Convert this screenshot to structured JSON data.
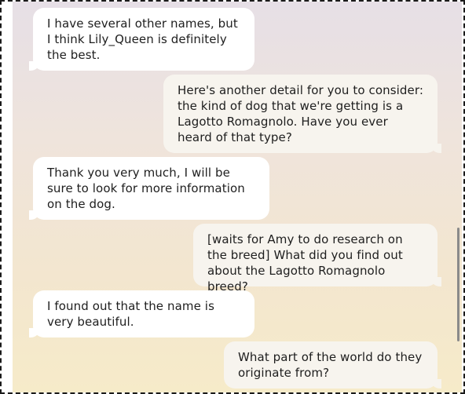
{
  "messages": [
    {
      "side": "left",
      "text": "I have several other names, but I think Lily_Queen is definitely the best."
    },
    {
      "side": "right",
      "text": "Here's another detail for you to consider: the kind of dog that we're getting is a Lagotto Romagnolo.  Have you ever heard of that type?"
    },
    {
      "side": "left",
      "text": "Thank you very much, I will be sure to look for more information on the dog."
    },
    {
      "side": "right",
      "text": "[waits for Amy to do research on the breed]  What did you find out about the Lagotto Romagnolo breed?"
    },
    {
      "side": "left",
      "text": "I found out that the name is very beautiful."
    },
    {
      "side": "right",
      "text": "What part of the world do they originate from?"
    }
  ]
}
